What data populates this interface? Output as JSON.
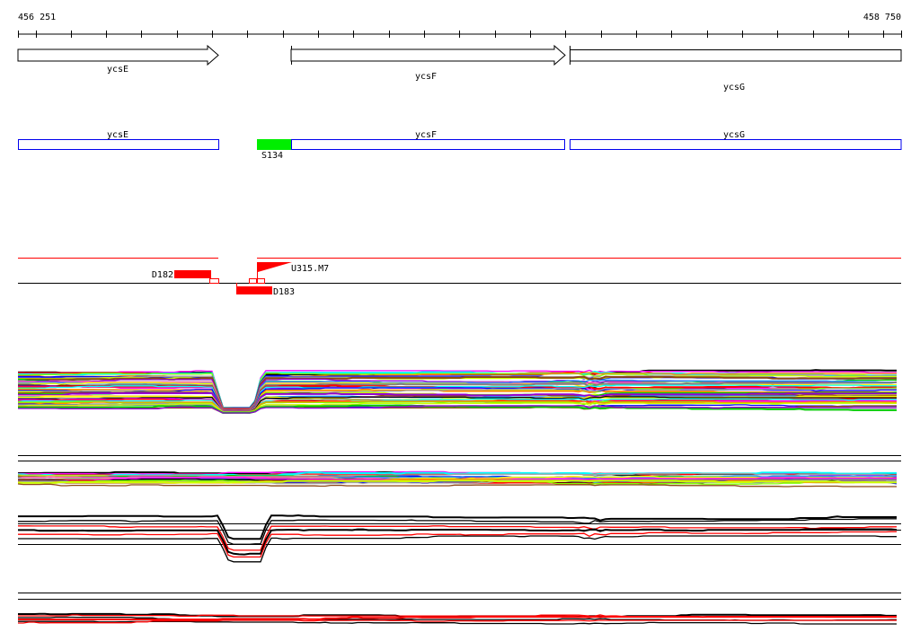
{
  "ruler": {
    "start": "456 251",
    "end": "458 750"
  },
  "genes": [
    {
      "name": "ycsE",
      "strand": "+"
    },
    {
      "name": "ycsF",
      "strand": "+"
    },
    {
      "name": "ycsG",
      "strand": "+"
    }
  ],
  "annotation_track": {
    "genes": [
      "ycsE",
      "ycsF",
      "ycsG"
    ],
    "feature": {
      "label": "S134",
      "color": "#00ee00"
    }
  },
  "features": {
    "d182": "D182",
    "d183": "D183",
    "u315": "U315.M7",
    "color": "#ff0000"
  },
  "track_colors": [
    "#000000",
    "#ff00ff",
    "#ff0000",
    "#00ffff",
    "#7fff00",
    "#ff8c00",
    "#0000ff",
    "#a0a0a0",
    "#ccff00",
    "#8b4513",
    "#00cc00",
    "#9400d3",
    "#ff69b4",
    "#1e90ff",
    "#ffff00",
    "#808080"
  ]
}
